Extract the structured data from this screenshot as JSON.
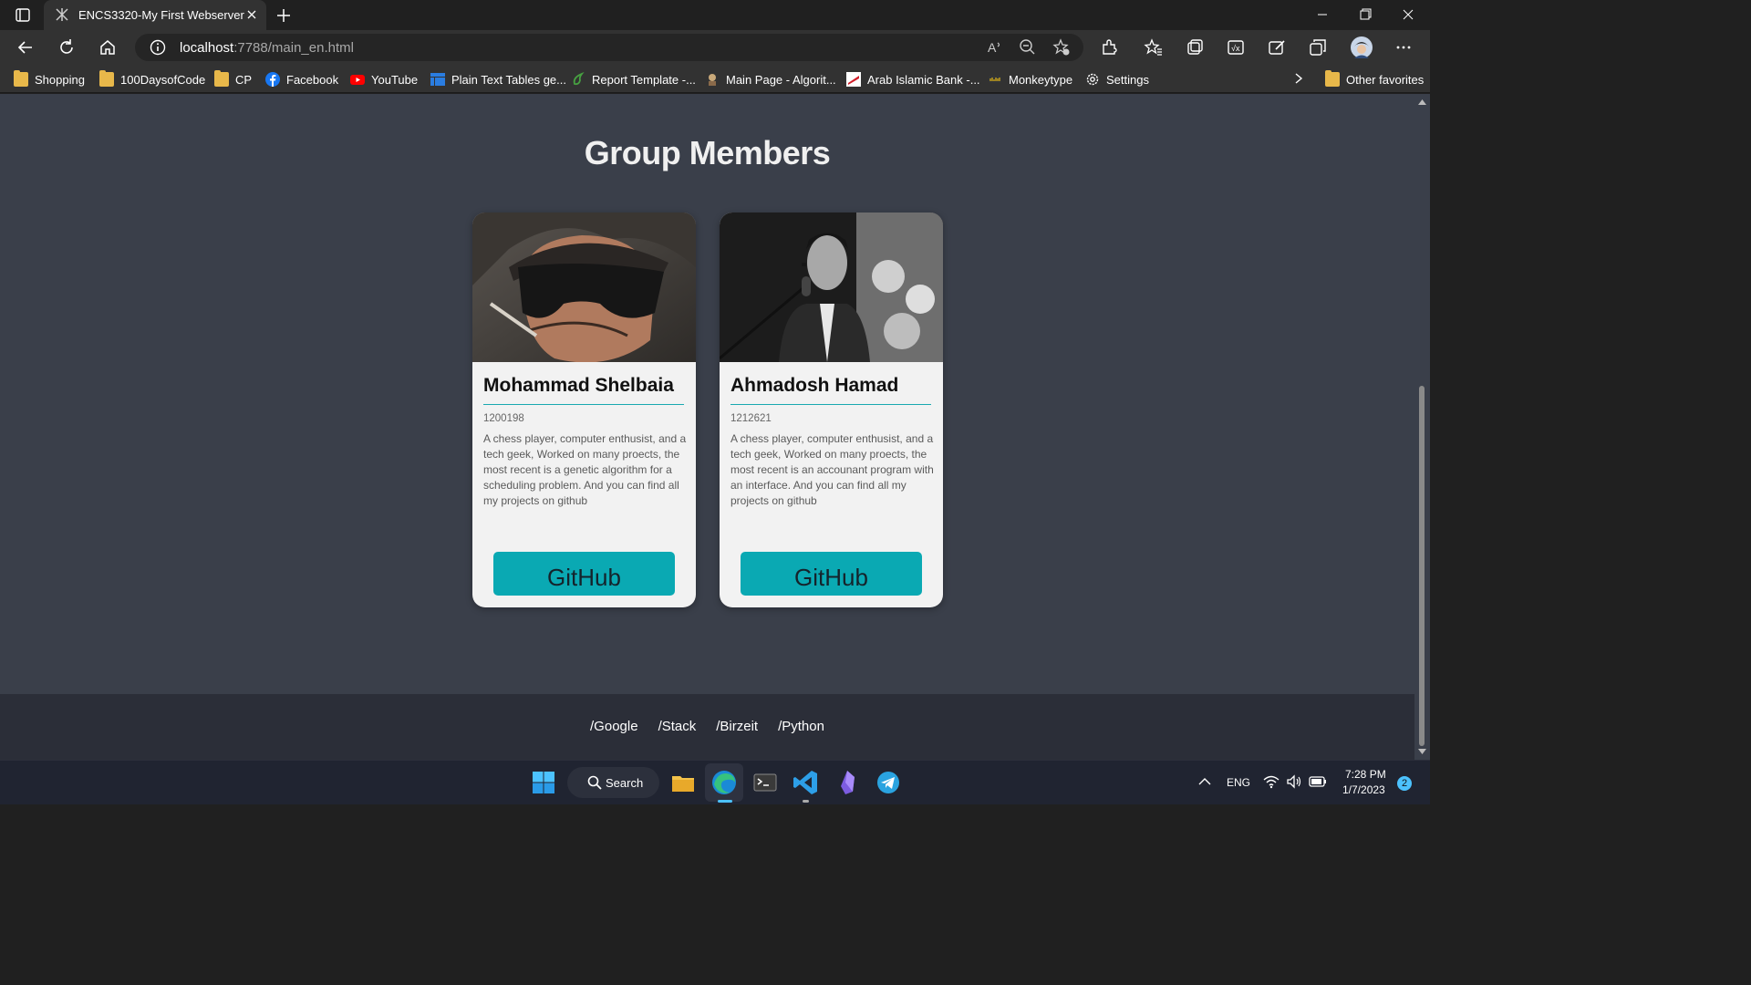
{
  "browser": {
    "tab_title": "ENCS3320-My First Webserver",
    "url_host": "localhost",
    "url_path": ":7788/main_en.html",
    "favorites": [
      {
        "label": "Shopping",
        "icon": "folder-icon"
      },
      {
        "label": "100DaysofCode",
        "icon": "folder-icon"
      },
      {
        "label": "CP",
        "icon": "folder-icon"
      },
      {
        "label": "Facebook",
        "icon": "facebook-icon"
      },
      {
        "label": "YouTube",
        "icon": "youtube-icon"
      },
      {
        "label": "Plain Text Tables ge...",
        "icon": "table-icon"
      },
      {
        "label": "Report Template -...",
        "icon": "overleaf-icon"
      },
      {
        "label": "Main Page - Algorit...",
        "icon": "algorithmica-icon"
      },
      {
        "label": "Arab Islamic Bank -...",
        "icon": "bank-icon"
      },
      {
        "label": "Monkeytype",
        "icon": "monkeytype-icon"
      },
      {
        "label": "Settings",
        "icon": "gear-icon"
      }
    ],
    "other_favorites": "Other favorites"
  },
  "page": {
    "title": "Group Members",
    "members": [
      {
        "name": "Mohammad Shelbaia",
        "id": "1200198",
        "description": "A chess player, computer enthusist, and a tech geek, Worked on many proects, the most recent is a genetic algorithm for a scheduling problem. And you can find all my projects on github",
        "button": "GitHub"
      },
      {
        "name": "Ahmadosh Hamad",
        "id": "1212621",
        "description": "A chess player, computer enthusist, and a tech geek, Worked on many proects, the most recent is an accounant program with an interface. And you can find all my projects on github",
        "button": "GitHub"
      }
    ],
    "footer_links": [
      "/Google",
      "/Stack",
      "/Birzeit",
      "/Python"
    ]
  },
  "taskbar": {
    "search_label": "Search",
    "language": "ENG",
    "time": "7:28 PM",
    "date": "1/7/2023",
    "notification_count": "2"
  },
  "colors": {
    "accent": "#0aa9b3",
    "page_bg": "#3a3f4a",
    "card_bg": "#f2f2f2"
  }
}
